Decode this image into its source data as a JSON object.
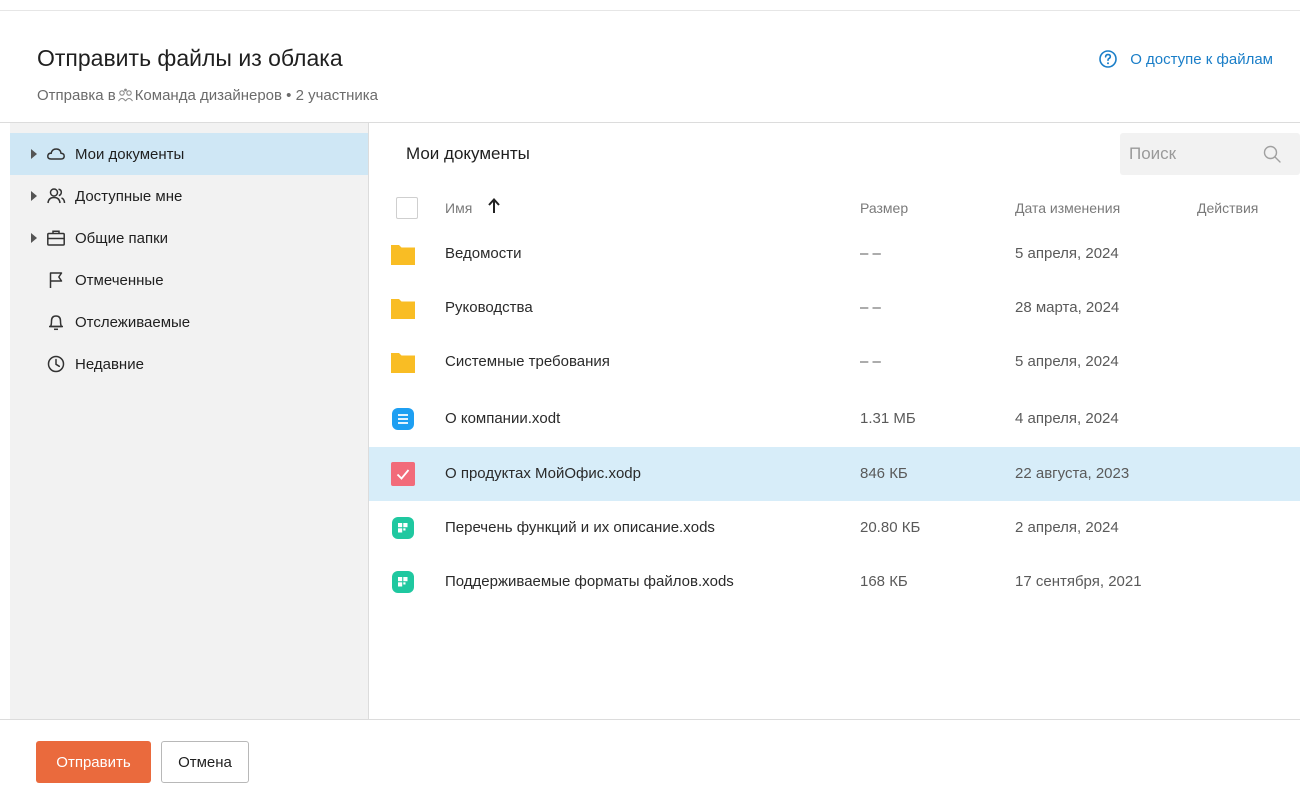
{
  "dialog": {
    "title": "Отправить файлы из облака",
    "subtitle_prefix": "Отправка в",
    "subtitle_team": "Команда дизайнеров • 2 участника",
    "help_link": "О доступе к файлам",
    "help_icon": "question-circle-icon"
  },
  "sidebar": {
    "items": [
      {
        "label": "Мои документы",
        "icon": "cloud-icon",
        "expandable": true,
        "active": true
      },
      {
        "label": "Доступные мне",
        "icon": "users-icon",
        "expandable": true,
        "active": false
      },
      {
        "label": "Общие папки",
        "icon": "briefcase-icon",
        "expandable": true,
        "active": false
      },
      {
        "label": "Отмеченные",
        "icon": "flag-icon",
        "expandable": false,
        "active": false
      },
      {
        "label": "Отслеживаемые",
        "icon": "bell-icon",
        "expandable": false,
        "active": false
      },
      {
        "label": "Недавние",
        "icon": "clock-icon",
        "expandable": false,
        "active": false
      }
    ]
  },
  "content": {
    "title": "Мои документы",
    "search_placeholder": "Поиск",
    "columns": {
      "name": "Имя",
      "size": "Размер",
      "date": "Дата изменения",
      "actions": "Действия"
    },
    "sort": {
      "column": "name",
      "direction": "ascending"
    },
    "rows": [
      {
        "type": "folder",
        "name": "Ведомости",
        "size": "– –",
        "date": "5 апреля, 2024",
        "selected": false
      },
      {
        "type": "folder",
        "name": "Руководства",
        "size": "– –",
        "date": "28 марта, 2024",
        "selected": false
      },
      {
        "type": "folder",
        "name": "Системные требования",
        "size": "– –",
        "date": "5 апреля, 2024",
        "selected": false
      },
      {
        "type": "text-document",
        "name": "О компании.xodt",
        "size": "1.31 МБ",
        "date": "4 апреля, 2024",
        "selected": false
      },
      {
        "type": "presentation",
        "name": "О продуктах МойОфис.xodp",
        "size": "846 КБ",
        "date": "22 августа, 2023",
        "selected": true
      },
      {
        "type": "spreadsheet",
        "name": "Перечень функций и их описание.xods",
        "size": "20.80 КБ",
        "date": "2 апреля, 2024",
        "selected": false
      },
      {
        "type": "spreadsheet",
        "name": "Поддерживаемые форматы файлов.xods",
        "size": "168 КБ",
        "date": "17 сентября, 2021",
        "selected": false
      }
    ]
  },
  "footer": {
    "send_label": "Отправить",
    "cancel_label": "Отмена"
  },
  "colors": {
    "accent": "#1a7ec8",
    "send_button": "#ea6a3d",
    "selected_row": "#d7edf9",
    "sidebar_active": "#cfe7f5",
    "folder": "#f9bd24",
    "text_document": "#1e9ff2",
    "presentation": "#f26b7a",
    "spreadsheet": "#1fc8a0"
  }
}
